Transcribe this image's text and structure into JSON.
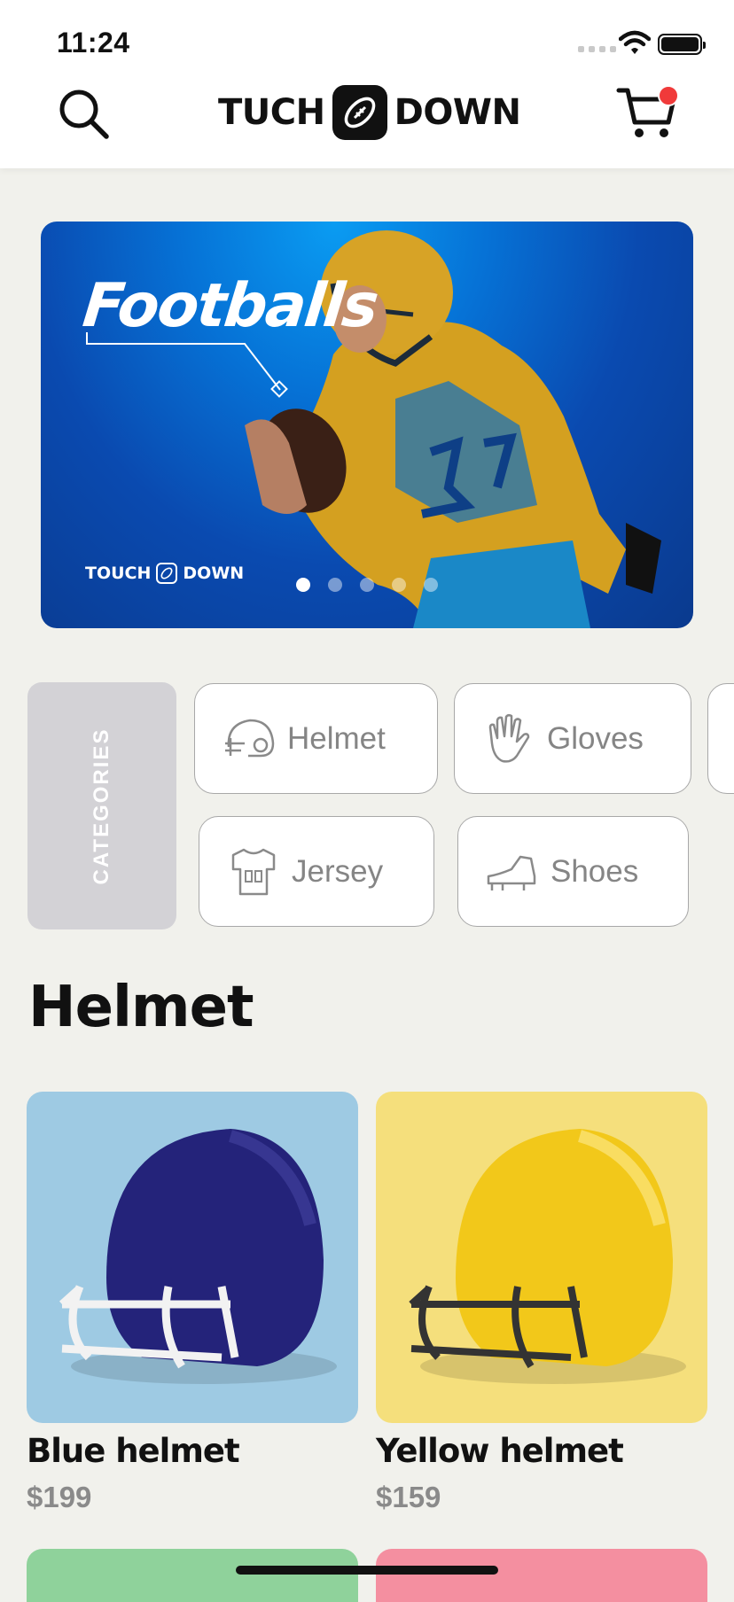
{
  "status": {
    "time": "11:24"
  },
  "header": {
    "brand_left": "TUCH",
    "brand_right": "DOWN"
  },
  "banner": {
    "title": "Footballs",
    "brand_left": "TOUCH",
    "brand_right": "DOWN",
    "slide_count": 5,
    "active_slide": 1,
    "colors": {
      "start": "#0a9cf2",
      "end": "#0a3a8e"
    }
  },
  "categories": {
    "label": "CATEGORIES",
    "items": [
      {
        "label": "Helmet",
        "icon": "helmet-icon"
      },
      {
        "label": "Gloves",
        "icon": "gloves-icon"
      },
      {
        "label": "Jersey",
        "icon": "jersey-icon"
      },
      {
        "label": "Shoes",
        "icon": "shoes-icon"
      }
    ]
  },
  "section": {
    "title": "Helmet"
  },
  "products": [
    {
      "name": "Blue helmet",
      "price": "$199",
      "bg": "#9ecae3",
      "helmet_color": "#24237a",
      "mask_color": "#f2f2f2"
    },
    {
      "name": "Yellow helmet",
      "price": "$159",
      "bg": "#f5df7c",
      "helmet_color": "#f2c81a",
      "mask_color": "#333333"
    }
  ],
  "next_row_colors": [
    "#8fd29b",
    "#f48fa0"
  ],
  "accent": {
    "badge": "#f03a3a"
  }
}
